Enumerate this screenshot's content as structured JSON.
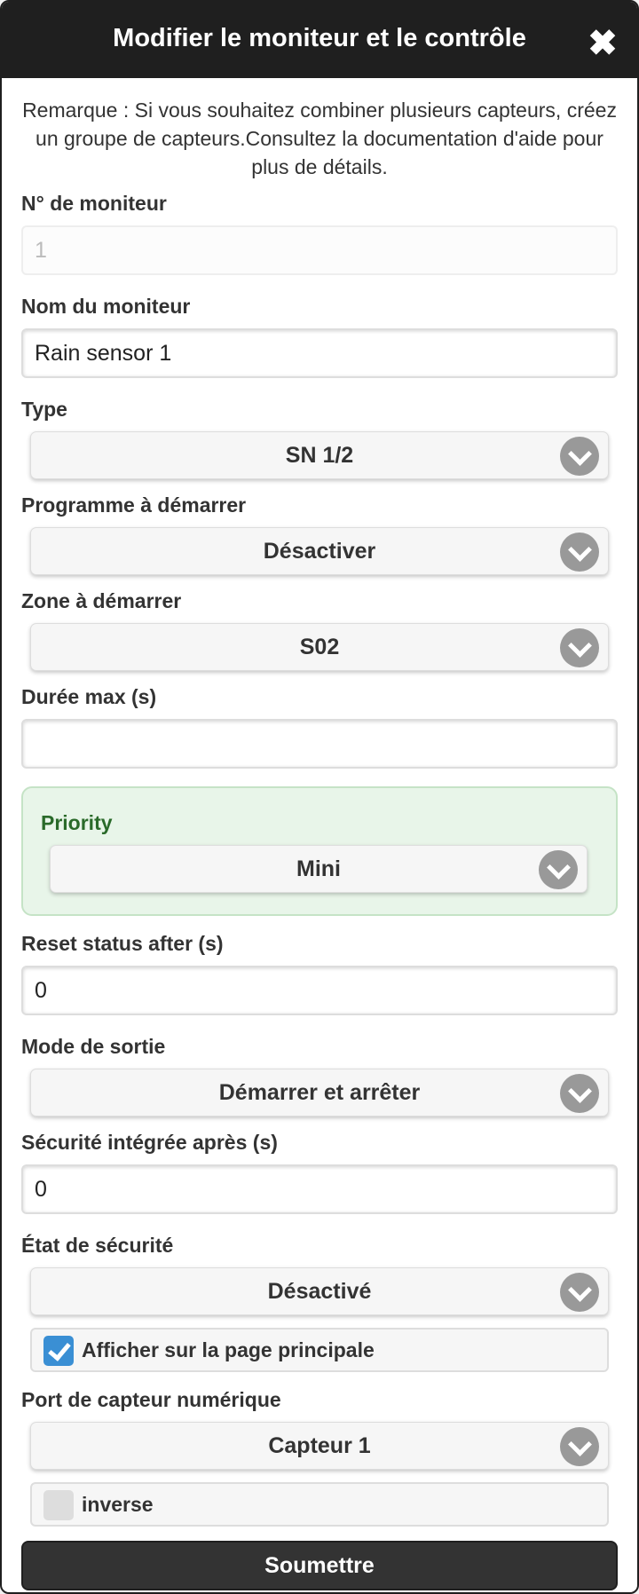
{
  "header": {
    "title": "Modifier le moniteur et le contrôle",
    "close_symbol": "✖"
  },
  "note": "Remarque : Si vous souhaitez combiner plusieurs capteurs, créez un groupe de capteurs.Consultez la documentation d'aide pour plus de détails.",
  "fields": {
    "monitor_no": {
      "label": "N° de moniteur",
      "value": "1"
    },
    "monitor_name": {
      "label": "Nom du moniteur",
      "value": "Rain sensor 1"
    },
    "type": {
      "label": "Type",
      "value": "SN 1/2"
    },
    "program": {
      "label": "Programme à démarrer",
      "value": "Désactiver"
    },
    "zone": {
      "label": "Zone à démarrer",
      "value": "S02"
    },
    "max_duration": {
      "label": "Durée max (s)",
      "value": ""
    },
    "priority": {
      "label": "Priority",
      "value": "Mini"
    },
    "reset_status": {
      "label": "Reset status after (s)",
      "value": "0"
    },
    "output_mode": {
      "label": "Mode de sortie",
      "value": "Démarrer et arrêter"
    },
    "failsafe_after": {
      "label": "Sécurité intégrée après (s)",
      "value": "0"
    },
    "safety_state": {
      "label": "État de sécurité",
      "value": "Désactivé"
    },
    "show_main": {
      "label": "Afficher sur la page principale",
      "checked": true
    },
    "digital_port": {
      "label": "Port de capteur numérique",
      "value": "Capteur 1"
    },
    "inverse": {
      "label": "inverse",
      "checked": false
    }
  },
  "submit_label": "Soumettre",
  "colors": {
    "header_bg": "#1f1f1f",
    "checkbox_blue": "#3a8fd4",
    "priority_bg": "#e8f5e9",
    "priority_text": "#2a6a2a"
  }
}
